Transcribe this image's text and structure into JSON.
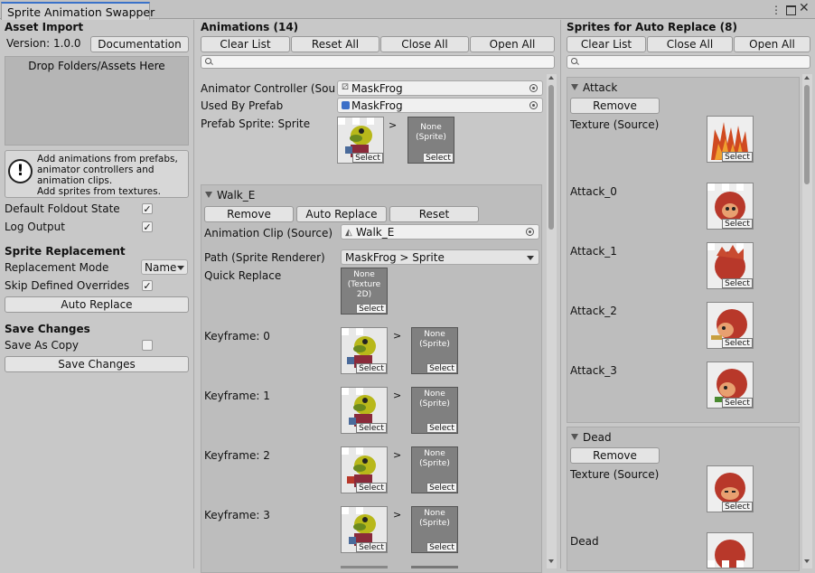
{
  "window": {
    "tab_title": "Sprite Animation Swapper",
    "menu_icon": "kebab-menu-icon",
    "maximize_icon": "maximize-icon",
    "close_icon": "close-icon"
  },
  "left": {
    "asset_import_title": "Asset Import",
    "version": "Version: 1.0.0",
    "documentation_label": "Documentation",
    "drop_label": "Drop Folders/Assets Here",
    "info_text": [
      "Add animations from prefabs,",
      "animator controllers and",
      "animation clips.",
      "Add sprites from textures."
    ],
    "default_foldout_label": "Default Foldout State",
    "default_foldout_checked": "✓",
    "log_output_label": "Log Output",
    "log_output_checked": "✓",
    "sprite_replacement_title": "Sprite Replacement",
    "replacement_mode_label": "Replacement Mode",
    "replacement_mode_value": "Name",
    "skip_overrides_label": "Skip Defined Overrides",
    "skip_overrides_checked": "✓",
    "auto_replace_label": "Auto Replace",
    "save_changes_title": "Save Changes",
    "save_as_copy_label": "Save As Copy",
    "save_changes_button": "Save Changes"
  },
  "animations": {
    "title": "Animations (14)",
    "buttons": [
      "Clear List",
      "Reset All",
      "Close All",
      "Open All"
    ],
    "search_placeholder": "",
    "animator_label": "Animator Controller (Source)",
    "animator_value": "MaskFrog",
    "prefab_label": "Used By Prefab",
    "prefab_value": "MaskFrog",
    "prefab_sprite_label": "Prefab Sprite: Sprite",
    "select_label": "Select",
    "arrow": ">",
    "none_sprite": [
      "None",
      "(Sprite)"
    ],
    "clip": {
      "name": "Walk_E",
      "remove": "Remove",
      "auto_replace": "Auto Replace",
      "reset": "Reset",
      "clip_label": "Animation Clip (Source)",
      "clip_value": "Walk_E",
      "path_label": "Path (Sprite Renderer)",
      "path_value": "MaskFrog > Sprite",
      "quick_label": "Quick Replace",
      "quick_none": [
        "None",
        "(Texture",
        "2D)"
      ],
      "keyframes": [
        "Keyframe: 0",
        "Keyframe: 1",
        "Keyframe: 2",
        "Keyframe: 3"
      ]
    }
  },
  "sprites": {
    "title": "Sprites for Auto Replace (8)",
    "buttons": [
      "Clear List",
      "Close All",
      "Open All"
    ],
    "search_placeholder": "",
    "groups": [
      {
        "name": "Attack",
        "remove": "Remove",
        "texture_label": "Texture (Source)",
        "items": [
          "Attack_0",
          "Attack_1",
          "Attack_2",
          "Attack_3"
        ]
      },
      {
        "name": "Dead",
        "remove": "Remove",
        "texture_label": "Texture (Source)",
        "items": [
          "Dead"
        ]
      }
    ]
  },
  "colors": {
    "frog_green": "#6b8a1e",
    "frog_yellow": "#b8b81a",
    "red_char": "#b8382a",
    "flame": "#d04a20"
  }
}
